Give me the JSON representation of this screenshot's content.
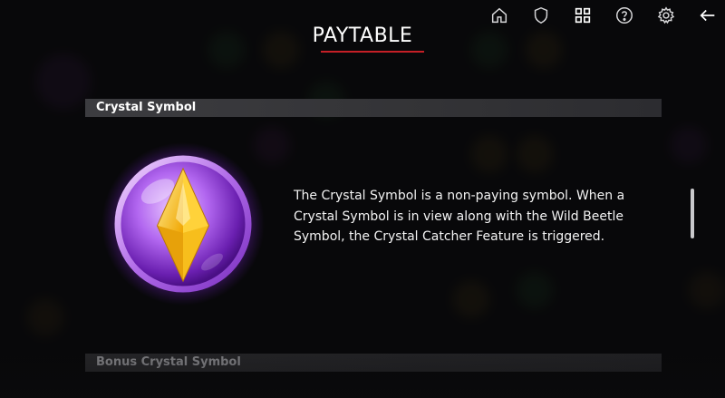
{
  "page": {
    "title": "PAYTABLE"
  },
  "toolbar": {
    "icons": [
      "home-icon",
      "shield-icon",
      "grid-icon",
      "help-icon",
      "settings-icon",
      "back-arrow-icon"
    ]
  },
  "sections": [
    {
      "header": "Crystal Symbol",
      "description": "The Crystal Symbol is a non-paying symbol. When a Crystal Symbol is in view along with the Wild Beetle Symbol, the Crystal Catcher Feature is triggered."
    },
    {
      "header": "Bonus Crystal Symbol"
    }
  ],
  "colors": {
    "accent_underline": "#c51f26",
    "orb_purple": "#9b3bff",
    "crystal_gold": "#f5c21b"
  }
}
